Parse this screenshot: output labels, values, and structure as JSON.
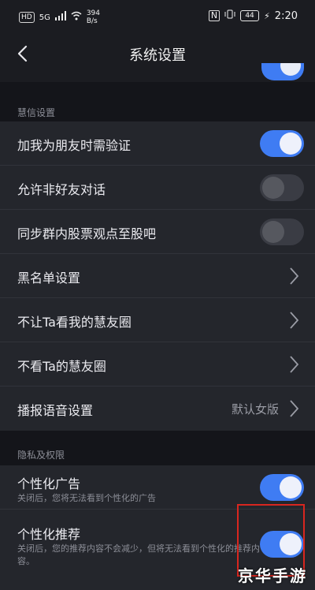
{
  "status_bar": {
    "hd": "HD",
    "signal": "5G",
    "speed_value": "394",
    "speed_unit": "B/s",
    "nfc": "N",
    "battery": "44",
    "time": "2:20"
  },
  "nav": {
    "title": "系统设置",
    "back_icon": "chevron-left-icon"
  },
  "sections": {
    "huixin": "慧信设置",
    "privacy": "隐私及权限"
  },
  "rows": {
    "friend_verify": {
      "label": "加我为朋友时需验证",
      "on": true
    },
    "non_friend_chat": {
      "label": "允许非好友对话",
      "on": false
    },
    "sync_stock": {
      "label": "同步群内股票观点至股吧",
      "on": false
    },
    "blacklist": {
      "label": "黑名单设置"
    },
    "hide_circle": {
      "label": "不让Ta看我的慧友圈"
    },
    "not_view_circle": {
      "label": "不看Ta的慧友圈"
    },
    "voice": {
      "label": "播报语音设置",
      "value": "默认女版"
    },
    "personal_ads": {
      "label": "个性化广告",
      "desc": "关闭后，您将无法看到个性化的广告",
      "on": true
    },
    "personal_recommend": {
      "label": "个性化推荐",
      "desc": "关闭后，您的推荐内容不会减少，但将无法看到个性化的推荐内容。",
      "on": true
    }
  },
  "watermark": "京华手游",
  "colors": {
    "accent": "#3f7cf3",
    "highlight": "#d8261f",
    "background": "#1b1c21"
  }
}
